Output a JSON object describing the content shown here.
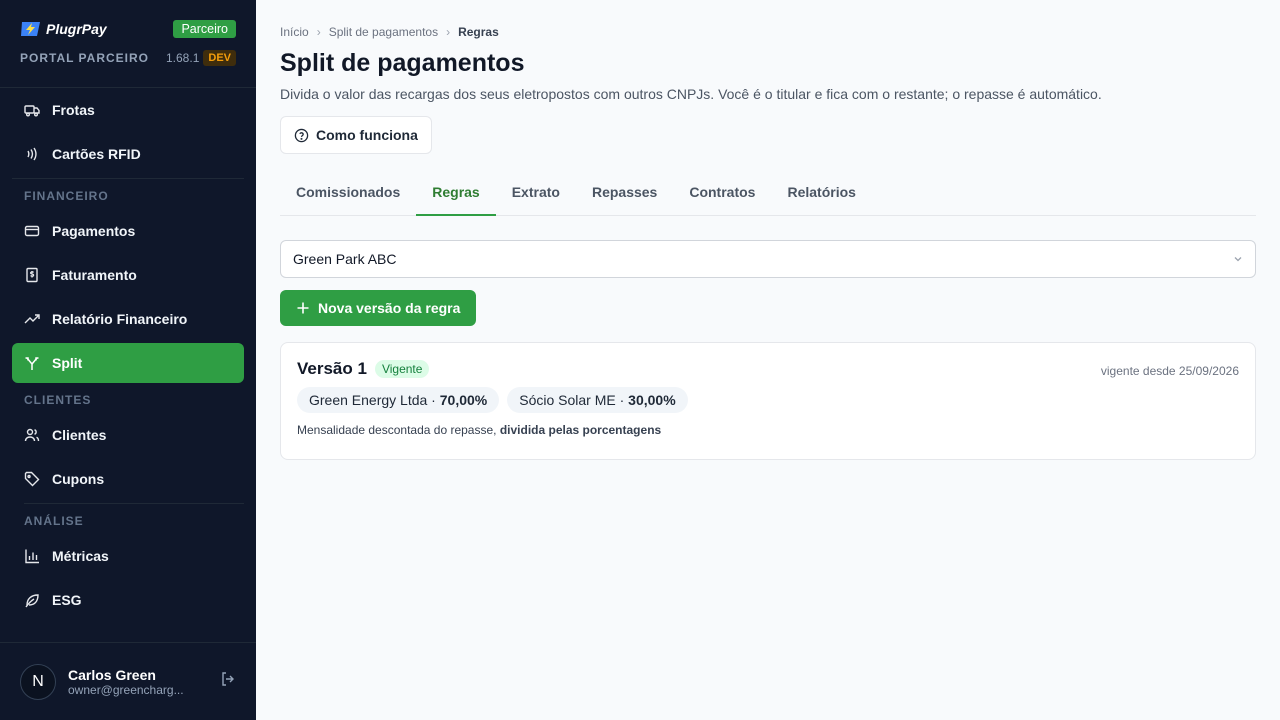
{
  "sidebar": {
    "brand_name": "PlugrPay",
    "partner_badge": "Parceiro",
    "portal_label": "PORTAL PARCEIRO",
    "version": "1.68.1",
    "env_badge": "DEV",
    "items_top": [
      {
        "label": "Frotas",
        "icon": "truck-icon"
      },
      {
        "label": "Cartões RFID",
        "icon": "nfc-icon"
      }
    ],
    "section_financeiro": "FINANCEIRO",
    "items_financeiro": [
      {
        "label": "Pagamentos",
        "icon": "credit-card-icon"
      },
      {
        "label": "Faturamento",
        "icon": "invoice-icon"
      },
      {
        "label": "Relatório Financeiro",
        "icon": "trend-up-icon"
      },
      {
        "label": "Split",
        "icon": "split-icon",
        "active": true
      }
    ],
    "section_clientes": "CLIENTES",
    "items_clientes": [
      {
        "label": "Clientes",
        "icon": "users-icon"
      },
      {
        "label": "Cupons",
        "icon": "tag-icon"
      }
    ],
    "section_analise": "ANÁLISE",
    "items_analise": [
      {
        "label": "Métricas",
        "icon": "bar-chart-icon"
      },
      {
        "label": "ESG",
        "icon": "leaf-icon"
      }
    ],
    "user": {
      "initial": "N",
      "name": "Carlos Green",
      "email": "owner@greencharg..."
    }
  },
  "main": {
    "breadcrumb": [
      "Início",
      "Split de pagamentos",
      "Regras"
    ],
    "title": "Split de pagamentos",
    "subtitle": "Divida o valor das recargas dos seus eletropostos com outros CNPJs. Você é o titular e fica com o restante; o repasse é automático.",
    "help_button": "Como funciona",
    "tabs": [
      {
        "label": "Comissionados"
      },
      {
        "label": "Regras",
        "active": true
      },
      {
        "label": "Extrato"
      },
      {
        "label": "Repasses"
      },
      {
        "label": "Contratos"
      },
      {
        "label": "Relatórios"
      }
    ],
    "station_select": "Green Park ABC",
    "new_rule_button": "Nova versão da regra",
    "rule_card": {
      "title": "Versão 1",
      "status": "Vigente",
      "since": "vigente desde 25/09/2026",
      "splits": [
        {
          "name": "Green Energy Ltda · ",
          "percent": "70,00%"
        },
        {
          "name": "Sócio Solar ME · ",
          "percent": "30,00%"
        }
      ],
      "note_prefix": "Mensalidade descontada do repasse, ",
      "note_bold": "dividida pelas porcentagens"
    }
  },
  "colors": {
    "accent": "#2f9e44",
    "sidebar_bg": "#0f172a",
    "dev_badge": "#f59e0b"
  }
}
